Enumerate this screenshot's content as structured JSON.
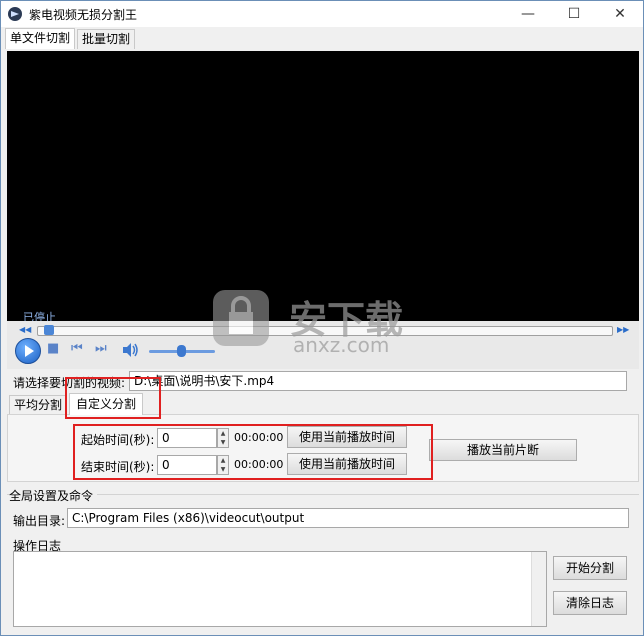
{
  "window": {
    "title": "紫电视频无损分割王",
    "controls": {
      "minimize": "—",
      "maximize": "☐",
      "close": "✕"
    }
  },
  "tabs_top": [
    "单文件切割",
    "批量切割"
  ],
  "player": {
    "status": "已停止",
    "seek_progress": 0.0
  },
  "video_select": {
    "label": "请选择要切割的视频:",
    "value": "D:\\桌面\\说明书\\安下.mp4"
  },
  "tabs_split": [
    "平均分割",
    "自定义分割"
  ],
  "custom_split": {
    "start_label": "起始时间(秒):",
    "start_value": "0",
    "start_time": "00:00:00",
    "end_label": "结束时间(秒):",
    "end_value": "0",
    "end_time": "00:00:00",
    "use_current_label": "使用当前播放时间",
    "play_segment_label": "播放当前片断"
  },
  "global": {
    "section_label": "全局设置及命令",
    "output_label": "输出目录:",
    "output_value": "C:\\Program Files (x86)\\videocut\\output",
    "log_label": "操作日志",
    "start_button": "开始分割",
    "clear_button": "清除日志"
  },
  "watermark": {
    "text_cn": "安下载",
    "text_en": "anxz.com"
  },
  "colors": {
    "highlight_red": "#e02020",
    "status_blue": "#8fb3e8"
  }
}
